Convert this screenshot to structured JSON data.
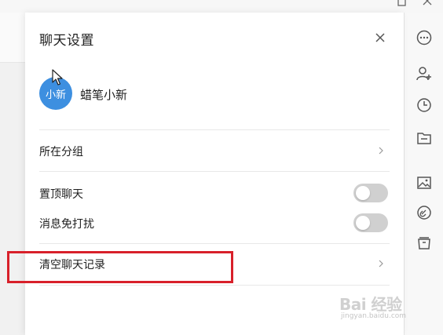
{
  "panel": {
    "title": "聊天设置"
  },
  "user": {
    "avatar_text": "小新",
    "name": "蜡笔小新"
  },
  "rows": {
    "group": {
      "label": "所在分组"
    },
    "pin_chat": {
      "label": "置顶聊天",
      "enabled": false
    },
    "mute": {
      "label": "消息免打扰",
      "enabled": false
    },
    "clear_history": {
      "label": "清空聊天记录"
    }
  },
  "rail_icons": [
    "more-icon",
    "add-contact-icon",
    "history-icon",
    "folder-icon",
    "image-icon",
    "link-icon",
    "archive-icon"
  ],
  "colors": {
    "avatar": "#3d8fe0",
    "highlight": "#d8202a",
    "toggle_off": "#d0d0d0"
  },
  "watermark": {
    "brand": "Bai 经验",
    "url": "jingyan.baidu.com"
  }
}
